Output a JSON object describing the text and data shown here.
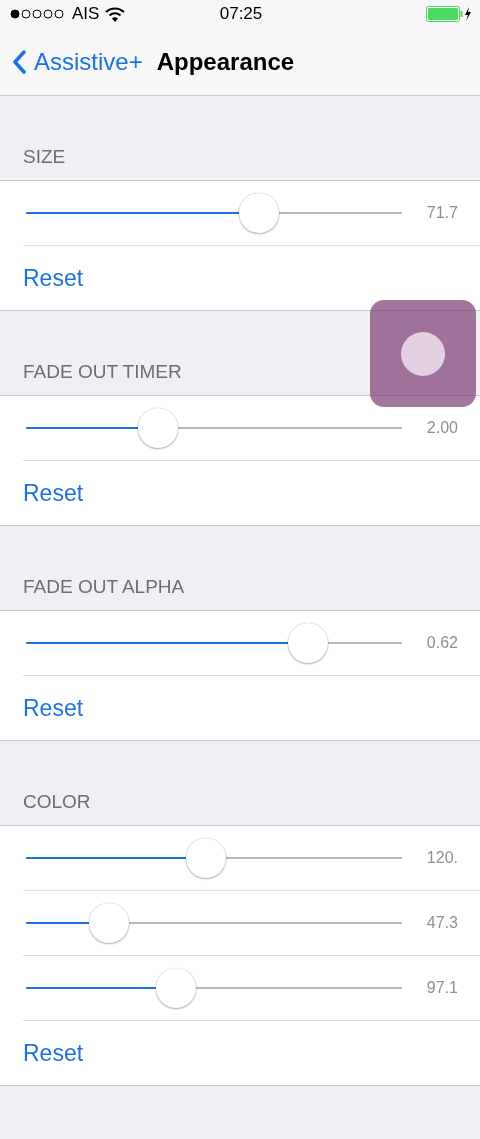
{
  "status_bar": {
    "carrier": "AIS",
    "time": "07:25"
  },
  "nav": {
    "back_label": "Assistive+",
    "title": "Appearance"
  },
  "sections": [
    {
      "header": "SIZE",
      "sliders": [
        {
          "level": 0.62,
          "reading": "71.7"
        }
      ],
      "reset": "Reset"
    },
    {
      "header": "FADE OUT TIMER",
      "sliders": [
        {
          "level": 0.35,
          "reading": "2.00"
        }
      ],
      "reset": "Reset"
    },
    {
      "header": "FADE OUT ALPHA",
      "sliders": [
        {
          "level": 0.75,
          "reading": "0.62"
        }
      ],
      "reset": "Reset"
    },
    {
      "header": "COLOR",
      "sliders": [
        {
          "level": 0.48,
          "reading": "120."
        },
        {
          "level": 0.22,
          "reading": "47.3"
        },
        {
          "level": 0.4,
          "reading": "97.1"
        }
      ],
      "reset": "Reset"
    }
  ]
}
